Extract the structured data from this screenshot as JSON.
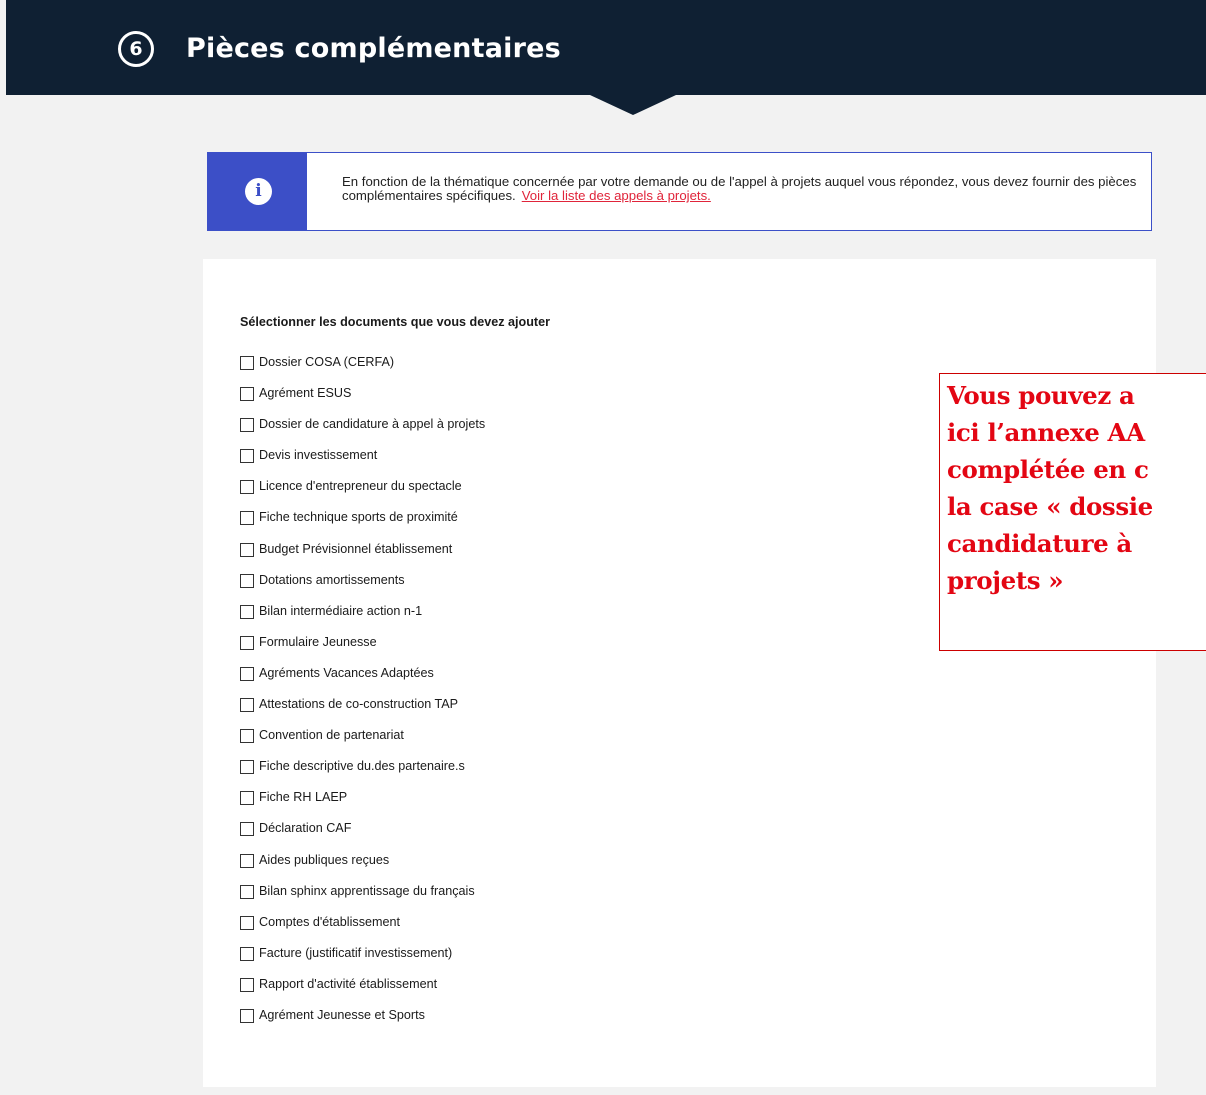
{
  "header": {
    "step_number": "6",
    "title": "Pièces complémentaires"
  },
  "info": {
    "icon": "info-icon",
    "icon_glyph": "i",
    "text": "En fonction de la thématique concernée par votre demande ou de l'appel à projets auquel vous répondez, vous devez fournir des pièces complémentaires spécifiques.",
    "link_text": "Voir la liste des appels à projets."
  },
  "documents": {
    "label": "Sélectionner les documents que vous devez ajouter",
    "items": [
      {
        "label": "Dossier COSA (CERFA)",
        "checked": false
      },
      {
        "label": "Agrément ESUS",
        "checked": false
      },
      {
        "label": "Dossier de candidature à appel à projets",
        "checked": false
      },
      {
        "label": "Devis investissement",
        "checked": false
      },
      {
        "label": "Licence d'entrepreneur du spectacle",
        "checked": false
      },
      {
        "label": "Fiche technique sports de proximité",
        "checked": false
      },
      {
        "label": "Budget Prévisionnel établissement",
        "checked": false
      },
      {
        "label": "Dotations amortissements",
        "checked": false
      },
      {
        "label": "Bilan intermédiaire action n-1",
        "checked": false
      },
      {
        "label": "Formulaire Jeunesse",
        "checked": false
      },
      {
        "label": "Agréments Vacances Adaptées",
        "checked": false
      },
      {
        "label": "Attestations de co-construction TAP",
        "checked": false
      },
      {
        "label": "Convention de partenariat",
        "checked": false
      },
      {
        "label": "Fiche descriptive du.des partenaire.s",
        "checked": false
      },
      {
        "label": "Fiche RH LAEP",
        "checked": false
      },
      {
        "label": "Déclaration CAF",
        "checked": false
      },
      {
        "label": "Aides publiques reçues",
        "checked": false
      },
      {
        "label": "Bilan sphinx apprentissage du français",
        "checked": false
      },
      {
        "label": "Comptes d'établissement",
        "checked": false
      },
      {
        "label": "Facture (justificatif investissement)",
        "checked": false
      },
      {
        "label": "Rapport d'activité établissement",
        "checked": false
      },
      {
        "label": "Agrément Jeunesse et Sports",
        "checked": false
      }
    ]
  },
  "annotation": {
    "lines": [
      "Vous pouvez a",
      "ici l’annexe AA",
      "complétée en c",
      "la case « dossie",
      "candidature à",
      "projets »"
    ]
  },
  "colors": {
    "header_bg": "#0f2033",
    "info_accent": "#3c4fc7",
    "link": "#e0243a",
    "annotation_red": "#e30613"
  }
}
